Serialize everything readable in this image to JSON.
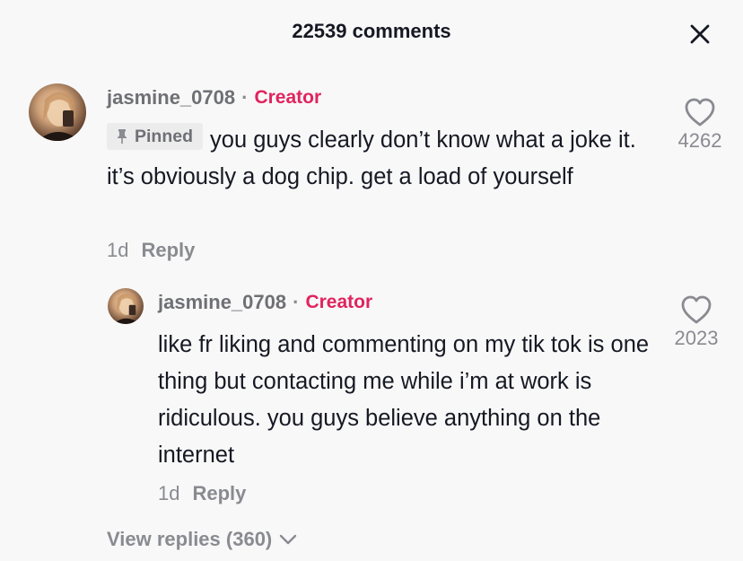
{
  "header": {
    "title": "22539 comments"
  },
  "comments": [
    {
      "username": "jasmine_0708",
      "separator": "·",
      "role": "Creator",
      "pinned_label": "Pinned",
      "text": "you guys clearly don’t know what a joke it. it’s obviously a dog chip. get a load of yourself",
      "time": "1d",
      "reply_label": "Reply",
      "likes": "4262",
      "avatar_icon": "user-photo"
    },
    {
      "username": "jasmine_0708",
      "separator": "·",
      "role": "Creator",
      "text": "like fr liking and commenting on my tik tok is one thing but contacting me while i’m at work is ridiculous. you guys believe anything on the internet",
      "time": "1d",
      "reply_label": "Reply",
      "likes": "2023",
      "avatar_icon": "user-photo"
    }
  ],
  "view_replies": {
    "label": "View replies (360)"
  },
  "colors": {
    "background": "#f8f8f8",
    "creator": "#e0245e",
    "muted": "#8a8b91",
    "text": "#161823"
  }
}
